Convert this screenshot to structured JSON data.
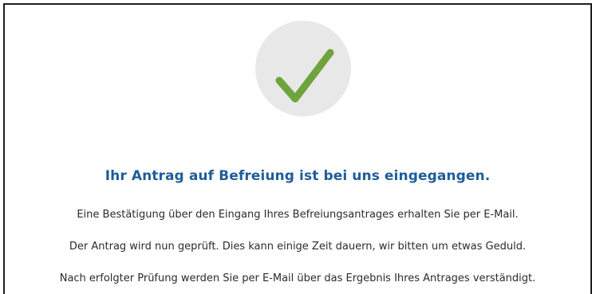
{
  "confirmation": {
    "icon": "checkmark-icon",
    "colors": {
      "circle": "#e8e8e8",
      "check": "#6fa33d",
      "title": "#1f5d9a"
    },
    "title": "Ihr Antrag auf Befreiung ist bei uns eingegangen.",
    "messages": [
      "Eine Bestätigung über den Eingang Ihres Befreiungsantrages erhalten Sie per E-Mail.",
      "Der Antrag wird nun geprüft. Dies kann einige Zeit dauern, wir bitten um etwas Geduld.",
      "Nach erfolgter Prüfung werden Sie per E-Mail über das Ergebnis Ihres Antrages verständigt."
    ]
  }
}
